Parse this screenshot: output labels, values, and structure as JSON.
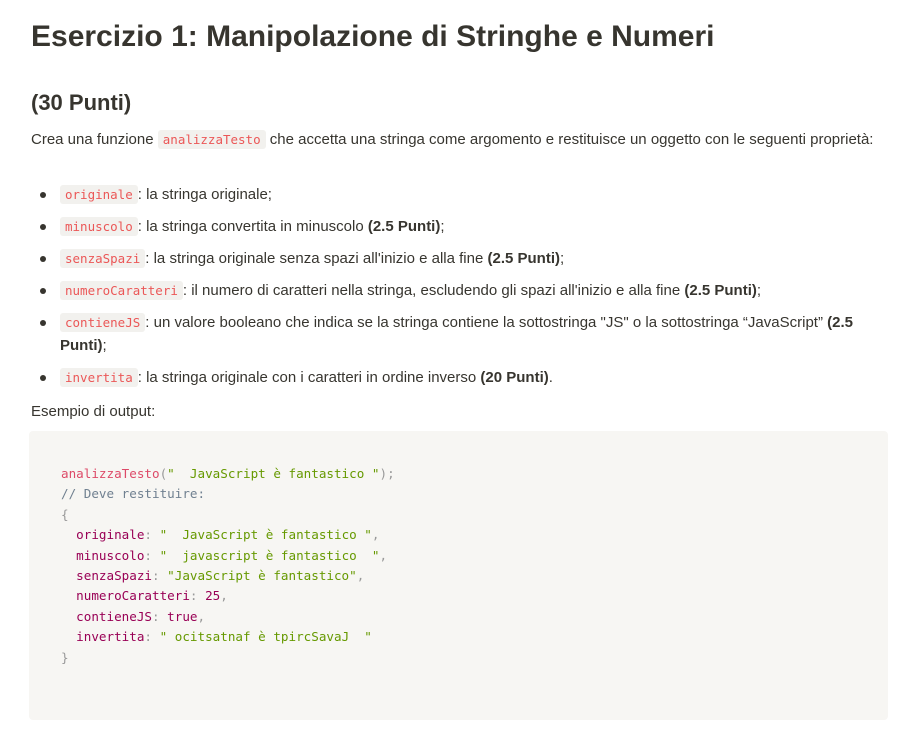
{
  "title": "Esercizio 1: Manipolazione di Stringhe e Numeri",
  "subtitle": "(30 Punti)",
  "intro": {
    "before": "Crea una funzione ",
    "fn_name": "analizzaTesto",
    "after": " che accetta una stringa come argomento e restituisce un oggetto con le seguenti proprietà:"
  },
  "properties": [
    {
      "code": "originale",
      "text": ": la stringa originale;",
      "points": "",
      "tail": ""
    },
    {
      "code": "minuscolo",
      "text": ": la stringa convertita in minuscolo ",
      "points": "(2.5 Punti)",
      "tail": ";"
    },
    {
      "code": "senzaSpazi",
      "text": ": la stringa originale senza spazi all'inizio e alla fine ",
      "points": "(2.5 Punti)",
      "tail": ";"
    },
    {
      "code": "numeroCaratteri",
      "text": ": il numero di caratteri nella stringa, escludendo gli spazi all'inizio e alla fine ",
      "points": "(2.5 Punti)",
      "tail": ";"
    },
    {
      "code": "contieneJS",
      "text": ": un valore booleano che indica se la stringa contiene la sottostringa \"JS\" o la sottostringa “JavaScript” ",
      "points": "(2.5 Punti)",
      "tail": ";"
    },
    {
      "code": "invertita",
      "text": ": la stringa originale con i caratteri in ordine inverso ",
      "points": "(20 Punti)",
      "tail": "."
    }
  ],
  "example_label": "Esempio di output:",
  "code": {
    "call_fn": "analizzaTesto",
    "call_arg": "\"  JavaScript è fantastico \"",
    "comment": "// Deve restituire:",
    "open_brace": "{",
    "close_brace": "}",
    "entries": [
      {
        "key": "originale",
        "value": "\"  JavaScript è fantastico \"",
        "kind": "str"
      },
      {
        "key": "minuscolo",
        "value": "\"  javascript è fantastico  \"",
        "kind": "str"
      },
      {
        "key": "senzaSpazi",
        "value": "\"JavaScript è fantastico\"",
        "kind": "str"
      },
      {
        "key": "numeroCaratteri",
        "value": "25",
        "kind": "num"
      },
      {
        "key": "contieneJS",
        "value": "true",
        "kind": "bool"
      },
      {
        "key": "invertita",
        "value": "\" ocitsatnaf è tpircSavaJ  \"",
        "kind": "str",
        "last": true
      }
    ]
  }
}
